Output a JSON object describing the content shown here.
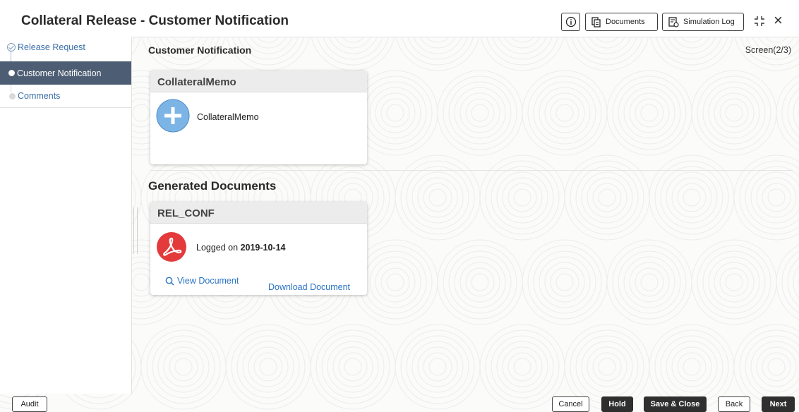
{
  "header": {
    "title": "Collateral Release - Customer Notification",
    "documents_label": "Documents",
    "simulation_log_label": "Simulation Log"
  },
  "sidebar": {
    "items": [
      {
        "label": "Release Request",
        "state": "completed"
      },
      {
        "label": "Customer Notification",
        "state": "active"
      },
      {
        "label": "Comments",
        "state": "pending"
      }
    ]
  },
  "main": {
    "section_title": "Customer Notification",
    "screen_indicator": "Screen(2/3)",
    "memo_card": {
      "title": "CollateralMemo",
      "item_label": "CollateralMemo"
    },
    "generated_title": "Generated Documents",
    "doc_card": {
      "title": "REL_CONF",
      "logged_prefix": "Logged on ",
      "logged_date": "2019-10-14",
      "view_label": "View Document",
      "download_label": "Download Document"
    }
  },
  "footer": {
    "audit_label": "Audit",
    "cancel_label": "Cancel",
    "hold_label": "Hold",
    "save_close_label": "Save & Close",
    "back_label": "Back",
    "next_label": "Next"
  },
  "colors": {
    "active_nav": "#4d5d73",
    "link": "#2a73c4",
    "pdf_red": "#e33b3b",
    "add_blue": "#7db4e6"
  },
  "icons": [
    "info-icon",
    "documents-icon",
    "simulation-log-icon",
    "collapse-icon",
    "close-icon",
    "add-icon",
    "pdf-icon",
    "search-icon"
  ]
}
